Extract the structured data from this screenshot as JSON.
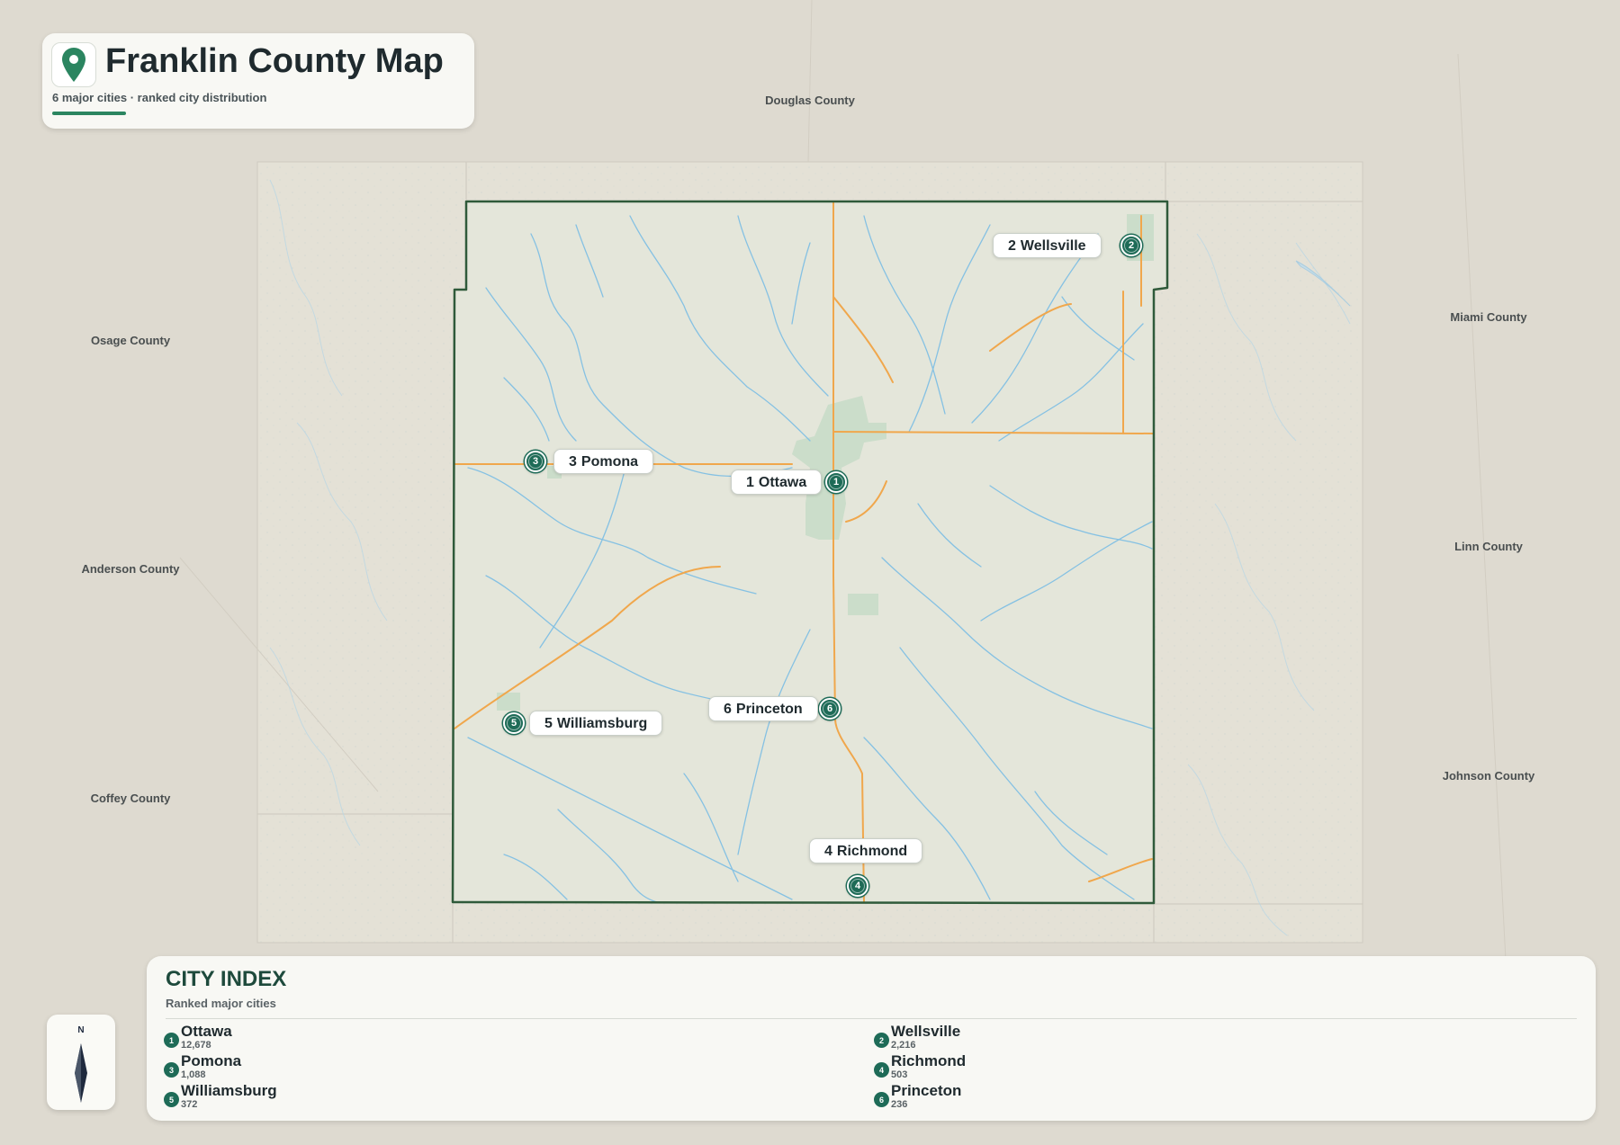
{
  "title": {
    "text": "Franklin County Map",
    "subtitle": "6 major cities · ranked city distribution",
    "icon": "map-pin-icon"
  },
  "colors": {
    "accent": "#2b8560",
    "marker": "#1e6b57",
    "border": "#2f5a3a",
    "water": "#7bbde0",
    "road": "#f0a74c",
    "urban": "#b7d3bb"
  },
  "neighbor_counties": [
    {
      "name": "Douglas County"
    },
    {
      "name": "Osage County"
    },
    {
      "name": "Anderson County"
    },
    {
      "name": "Coffey County"
    },
    {
      "name": "Miami County"
    },
    {
      "name": "Linn County"
    },
    {
      "name": "Johnson County"
    }
  ],
  "cities": [
    {
      "rank": "1",
      "name": "Ottawa",
      "population": "12,678"
    },
    {
      "rank": "2",
      "name": "Wellsville",
      "population": "2,216"
    },
    {
      "rank": "3",
      "name": "Pomona",
      "population": "1,088"
    },
    {
      "rank": "4",
      "name": "Richmond",
      "population": "503"
    },
    {
      "rank": "5",
      "name": "Williamsburg",
      "population": "372"
    },
    {
      "rank": "6",
      "name": "Princeton",
      "population": "236"
    }
  ],
  "index": {
    "title": "CITY INDEX",
    "subtitle": "Ranked major cities"
  },
  "compass": {
    "north_label": "N",
    "icon": "compass-arrow-icon"
  }
}
